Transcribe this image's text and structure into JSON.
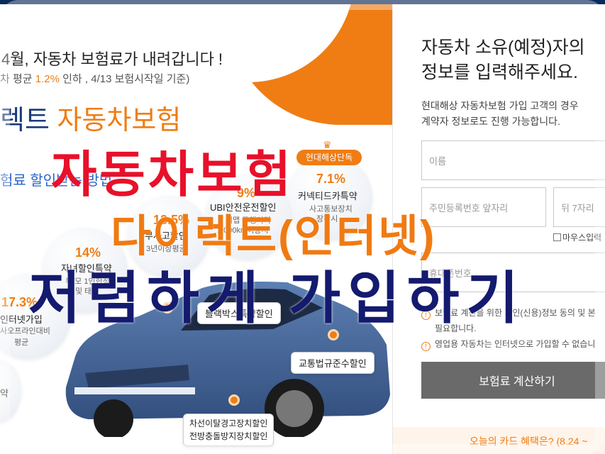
{
  "left": {
    "headline": "4월, 자동차 보험료가 내려갑니다 !",
    "subline_pre": "차 평균 ",
    "subline_rate": "1.2%",
    "subline_post": " 인하 , 4/13 보험시작일 기준)",
    "brand_part1": "렉트 ",
    "brand_part2": "자동차보험",
    "discount_link": "험료 할인받는 방법",
    "exclusive_badge": "현대해상단독",
    "items": [
      {
        "pct": "7.1%",
        "label": "커넥티드카특약",
        "sub1": "사고통보장치",
        "sub2": "장착시"
      },
      {
        "pct": "9%",
        "label": "UBI안전운전할인",
        "sub1": "티맵 주행거리",
        "sub2": "1,000km이상시"
      },
      {
        "pct": "13.5%",
        "label": "무사고할인",
        "sub1": "3년이상평균",
        "sub2": ""
      },
      {
        "pct": "14%",
        "label": "자녀할인특약",
        "sub1": "부/모 1인한정",
        "sub2": "및 태아"
      },
      {
        "pct": "17.3%",
        "label": "인터넷가입",
        "sub1": "사오프라인대비",
        "sub2": "평균"
      }
    ],
    "edge_label": "약",
    "tags": {
      "blackbox": "블랙박스특약할인",
      "traffic": "교통법규준수할인",
      "lane_line1": "차선이탈경고장치할인",
      "lane_line2": "전방충돌방지장치할인"
    }
  },
  "right": {
    "title_line1": "자동차 소유(예정)자의",
    "title_line2": "정보를 입력해주세요.",
    "desc_line1": "현대해상 자동차보험 가입 고객의 경우",
    "desc_line2": "계약자 정보로도 진행 가능합니다.",
    "name_placeholder": "이름",
    "rrn_front_placeholder": "주민등록번호 앞자리",
    "rrn_back_placeholder": "뒤 7자리",
    "mouse_input_label": "마우스입력",
    "phone_placeholder": "휴대폰번호",
    "note1_line1": "보험료 계산을 위한 개인(신용)정보 동의 및 본",
    "note1_line2": "필요합니다.",
    "note2": "영업용 자동차는 인터넷으로 가입할 수 없습니",
    "calc_button": "보험료 계산하기",
    "card_benefit": "오늘의 카드 혜택은? (8.24 ~"
  },
  "overlay": {
    "line1": "자동차보험",
    "line2": "다이렉트(인터넷)",
    "line3": "저렴하게 가입하기"
  },
  "colors": {
    "accent_orange": "#ef7d14",
    "navy": "#141a6e",
    "red": "#e8102a",
    "brand_blue": "#1a3a7a"
  }
}
